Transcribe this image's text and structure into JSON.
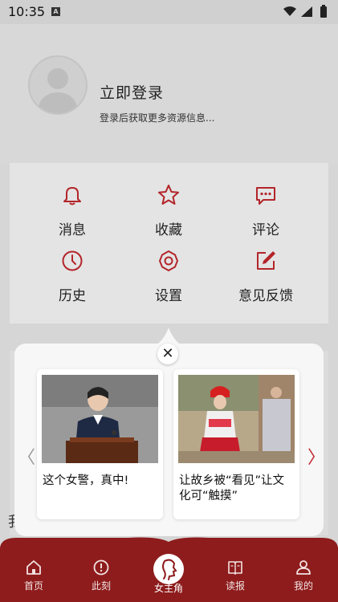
{
  "status_bar": {
    "time": "10:35",
    "notification_badge": "A"
  },
  "profile": {
    "login_title": "立即登录",
    "login_subtitle": "登录后获取更多资源信息..."
  },
  "menu": {
    "items": [
      {
        "label": "消息",
        "icon": "bell-icon"
      },
      {
        "label": "收藏",
        "icon": "star-icon"
      },
      {
        "label": "评论",
        "icon": "comment-icon"
      },
      {
        "label": "历史",
        "icon": "clock-icon"
      },
      {
        "label": "设置",
        "icon": "gear-icon"
      },
      {
        "label": "意见反馈",
        "icon": "edit-icon"
      }
    ]
  },
  "background_fragment": {
    "left_char": "我"
  },
  "popup": {
    "cards": [
      {
        "title": "这个女警，真中!"
      },
      {
        "title": "让故乡被“看见”让文化可“触摸”"
      }
    ],
    "prev_arrow": "〈",
    "next_arrow": "〉"
  },
  "tabbar": {
    "items": [
      {
        "label": "首页",
        "icon": "home-icon"
      },
      {
        "label": "此刻",
        "icon": "alert-circle-icon"
      },
      {
        "label": "女主角",
        "icon": "profile-silhouette-icon"
      },
      {
        "label": "读报",
        "icon": "book-icon"
      },
      {
        "label": "我的",
        "icon": "person-icon"
      }
    ]
  },
  "colors": {
    "accent": "#b3252a",
    "tabbar_bg": "#8e1c1c"
  }
}
